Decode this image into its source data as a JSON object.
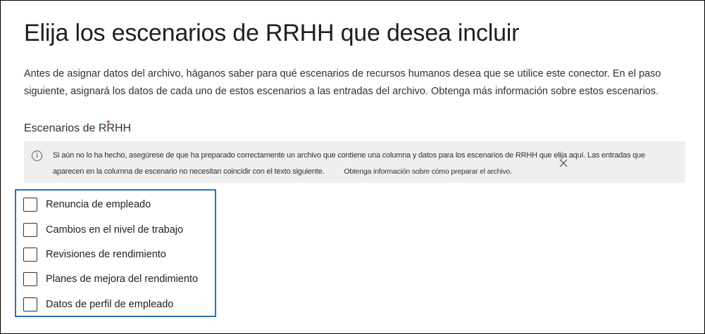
{
  "page": {
    "title": "Elija los escenarios de RRHH que desea incluir",
    "description": "Antes de asignar datos del archivo, háganos saber para qué escenarios de recursos humanos desea que se utilice este conector. En el paso siguiente, asignará los datos de cada uno de estos escenarios a las entradas del archivo. Obtenga más información sobre estos escenarios."
  },
  "scenarios_section": {
    "label": "Escenarios de RRHH",
    "required_mark": "*"
  },
  "info_banner": {
    "icon": "info-icon",
    "icon_glyph": "i",
    "line1": "Si aún no lo ha hecho, asegúrese de que ha preparado correctamente un archivo que contiene una columna y datos para los escenarios de RRHH que elija aquí. Las entradas que",
    "line2": "aparecen en la columna de escenario no necesitan coincidir con el texto siguiente.",
    "link": "Obtenga información sobre cómo preparar el archivo."
  },
  "scenarios": [
    {
      "label": "Renuncia de empleado",
      "checked": false
    },
    {
      "label": "Cambios en el nivel de trabajo",
      "checked": false
    },
    {
      "label": "Revisiones de rendimiento",
      "checked": false
    },
    {
      "label": "Planes de mejora del rendimiento",
      "checked": false
    },
    {
      "label": "Datos de perfil de empleado",
      "checked": false
    }
  ],
  "colors": {
    "focus_border": "#2b70b0",
    "info_background": "#efefef",
    "required": "#a4262c"
  }
}
